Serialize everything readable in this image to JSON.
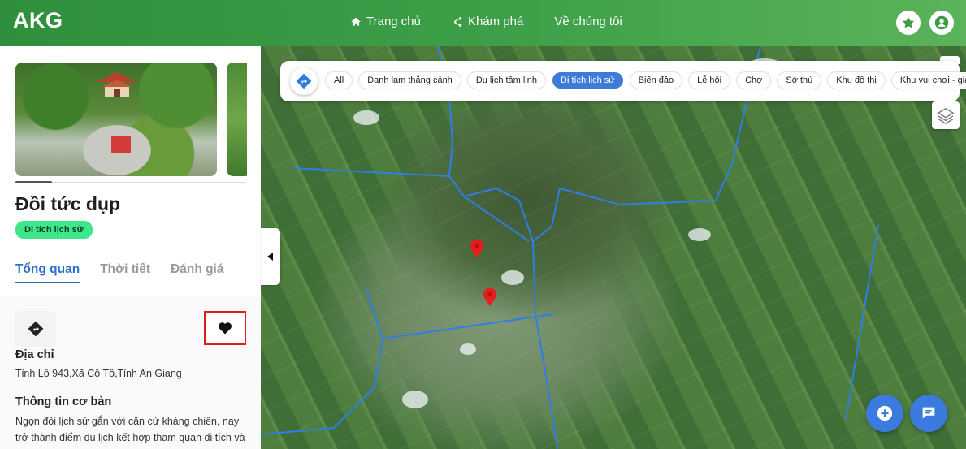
{
  "header": {
    "logo": "AKG",
    "nav": [
      {
        "label": "Trang chủ",
        "icon": "home-icon"
      },
      {
        "label": "Khám phá",
        "icon": "share-icon"
      },
      {
        "label": "Về chúng tôi",
        "icon": ""
      }
    ],
    "actions": [
      {
        "icon": "star-icon"
      },
      {
        "icon": "user-icon"
      }
    ],
    "colors": {
      "brand": "#3ea149"
    }
  },
  "place": {
    "title": "Đồi tức dụp",
    "category": "Di tích lịch sử",
    "tabs": [
      {
        "label": "Tổng quan",
        "active": true
      },
      {
        "label": "Thời tiết",
        "active": false
      },
      {
        "label": "Đánh giá",
        "active": false
      }
    ],
    "address_label": "Địa chỉ",
    "address": "Tỉnh Lộ 943,Xã Cô Tô,Tỉnh An Giang",
    "info_label": "Thông tin cơ bản",
    "info_line1": "Ngọn đồi lịch sử gắn với căn cứ kháng chiến, nay",
    "info_line2": "trở thành điểm du lịch kết hợp tham quan di tích và"
  },
  "filters": {
    "items": [
      {
        "label": "All",
        "active": false
      },
      {
        "label": "Danh lam thắng cảnh",
        "active": false
      },
      {
        "label": "Du lịch tâm linh",
        "active": false
      },
      {
        "label": "Di tích lịch sử",
        "active": true
      },
      {
        "label": "Biển đảo",
        "active": false
      },
      {
        "label": "Lễ hội",
        "active": false
      },
      {
        "label": "Chợ",
        "active": false
      },
      {
        "label": "Sở thú",
        "active": false
      },
      {
        "label": "Khu đô thị",
        "active": false
      },
      {
        "label": "Khu vui chơi - giải trí",
        "active": false
      }
    ],
    "active_color": "#3d7bd8"
  },
  "map": {
    "markers": [
      {
        "icon": "map-pin-icon"
      },
      {
        "icon": "map-pin-icon"
      }
    ],
    "controls": [
      {
        "icon": "layers-icon"
      },
      {
        "icon": "plus-icon"
      },
      {
        "icon": "chat-icon"
      }
    ]
  }
}
